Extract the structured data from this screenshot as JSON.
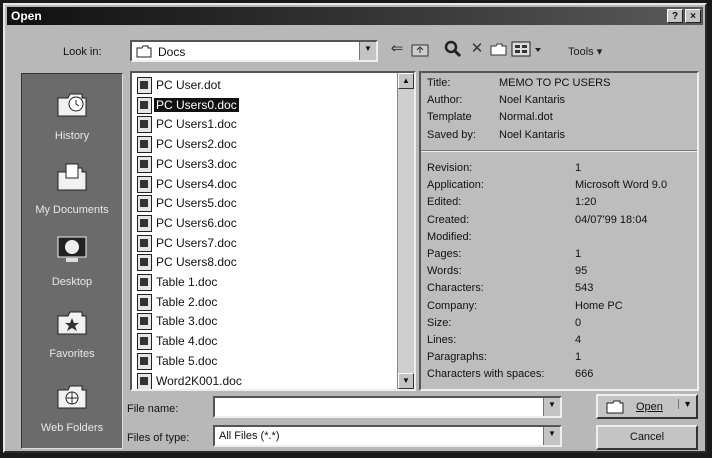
{
  "window": {
    "title": "Open",
    "help_button": "?",
    "close_button": "×"
  },
  "lookin": {
    "label": "Look in:",
    "value": "Docs"
  },
  "toolbar": {
    "back_icon": "back-arrow-icon",
    "up_icon": "up-folder-icon",
    "search_icon": "search-web-icon",
    "delete_icon": "delete-icon",
    "newfolder_icon": "new-folder-icon",
    "views_icon": "views-icon",
    "tools_label": "Tools ▾"
  },
  "places": [
    {
      "label": "History",
      "icon": "history-icon"
    },
    {
      "label": "My Documents",
      "icon": "my-documents-icon"
    },
    {
      "label": "Desktop",
      "icon": "desktop-icon"
    },
    {
      "label": "Favorites",
      "icon": "favorites-icon"
    },
    {
      "label": "Web Folders",
      "icon": "web-folders-icon"
    }
  ],
  "files": [
    {
      "name": "PC User.dot",
      "selected": false
    },
    {
      "name": "PC Users0.doc",
      "selected": true
    },
    {
      "name": "PC Users1.doc",
      "selected": false
    },
    {
      "name": "PC Users2.doc",
      "selected": false
    },
    {
      "name": "PC Users3.doc",
      "selected": false
    },
    {
      "name": "PC Users4.doc",
      "selected": false
    },
    {
      "name": "PC Users5.doc",
      "selected": false
    },
    {
      "name": "PC Users6.doc",
      "selected": false
    },
    {
      "name": "PC Users7.doc",
      "selected": false
    },
    {
      "name": "PC Users8.doc",
      "selected": false
    },
    {
      "name": "Table 1.doc",
      "selected": false
    },
    {
      "name": "Table 2.doc",
      "selected": false
    },
    {
      "name": "Table 3.doc",
      "selected": false
    },
    {
      "name": "Table 4.doc",
      "selected": false
    },
    {
      "name": "Table 5.doc",
      "selected": false
    },
    {
      "name": "Word2K001.doc",
      "selected": false
    }
  ],
  "preview": {
    "summary": [
      {
        "key": "Title:",
        "value": "MEMO TO PC USERS"
      },
      {
        "key": "Author:",
        "value": "Noel Kantaris"
      },
      {
        "key": "Template",
        "value": "Normal.dot"
      },
      {
        "key": "Saved by:",
        "value": "Noel Kantaris"
      }
    ],
    "stats": [
      {
        "key": "Revision:",
        "value": "1"
      },
      {
        "key": "Application:",
        "value": "Microsoft Word 9.0"
      },
      {
        "key": "Edited:",
        "value": "1:20"
      },
      {
        "key": "Created:",
        "value": "04/07'99 18:04"
      },
      {
        "key": "Modified:",
        "value": ""
      },
      {
        "key": "Pages:",
        "value": "1"
      },
      {
        "key": "Words:",
        "value": "95"
      },
      {
        "key": "Characters:",
        "value": "543"
      },
      {
        "key": "Company:",
        "value": "Home PC"
      },
      {
        "key": "Size:",
        "value": "0"
      },
      {
        "key": "Lines:",
        "value": "4"
      },
      {
        "key": "Paragraphs:",
        "value": "1"
      },
      {
        "key": "Characters with spaces:",
        "value": "666"
      }
    ]
  },
  "filename": {
    "label": "File name:",
    "value": ""
  },
  "filetype": {
    "label": "Files of type:",
    "value": "All Files (*.*)"
  },
  "buttons": {
    "open": "Open",
    "cancel": "Cancel"
  }
}
